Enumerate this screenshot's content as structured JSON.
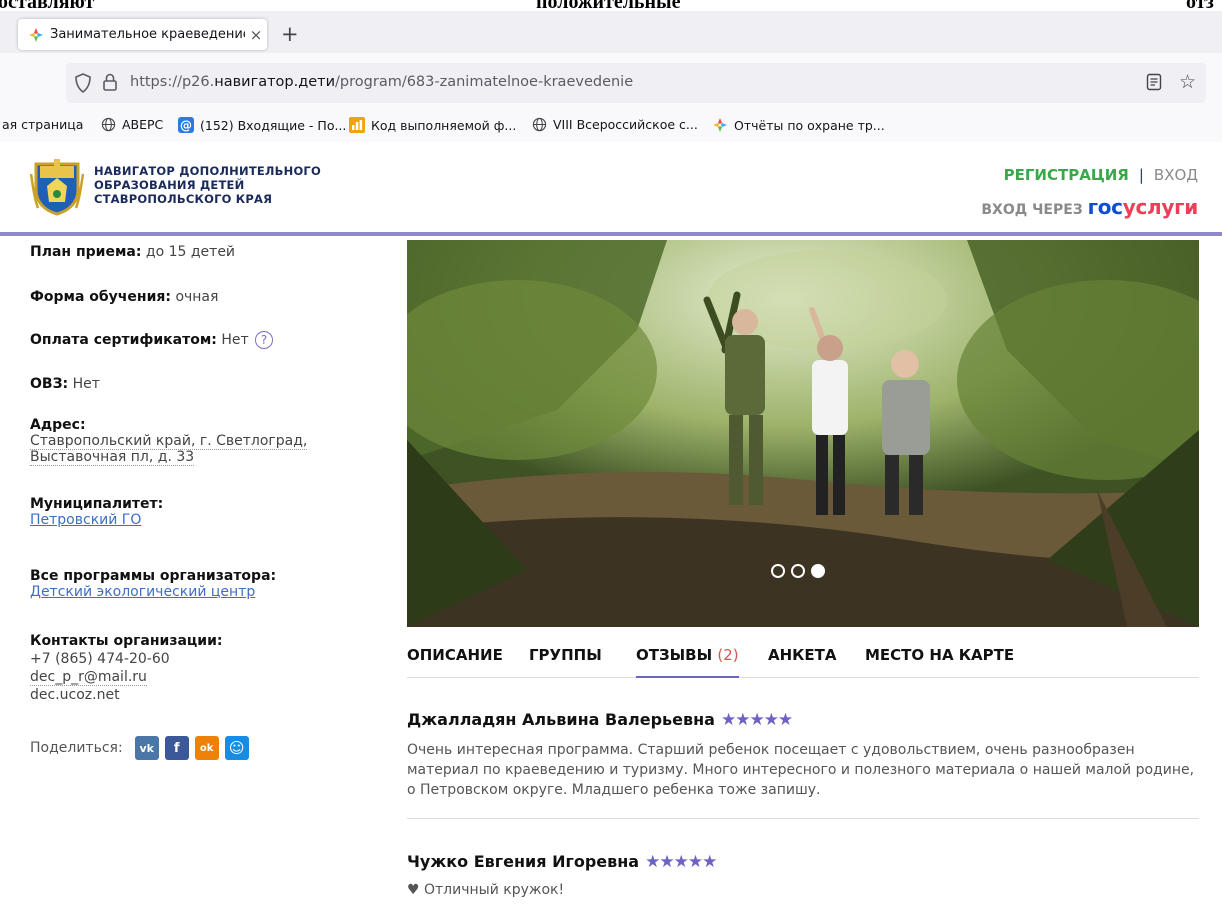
{
  "doc_crop": {
    "left": "оставляют",
    "mid": "положительные",
    "right": "отз"
  },
  "browser": {
    "tab_title": "Занимательное краеведение",
    "tab_close": "×",
    "new_tab": "+",
    "url_prefix": "https://p26.",
    "url_domain": "навигатор.дети",
    "url_path": "/program/683-zanimatelnoe-kraevedenie",
    "bookmarks": [
      {
        "label": "ая страница",
        "icon": "none"
      },
      {
        "label": "ABEPC",
        "icon": "globe-icon"
      },
      {
        "label": "(152) Входящие - По...",
        "icon": "mail-icon"
      },
      {
        "label": "Код выполняемой ф...",
        "icon": "bars-icon"
      },
      {
        "label": "VIII Всероссийское с...",
        "icon": "globe-icon"
      },
      {
        "label": "Отчёты по охране тр...",
        "icon": "flower-icon"
      }
    ]
  },
  "header": {
    "brand_line1": "НАВИГАТОР ДОПОЛНИТЕЛЬНОГО",
    "brand_line2": "ОБРАЗОВАНИЯ ДЕТЕЙ",
    "brand_line3": "СТАВРОПОЛЬСКОГО КРАЯ",
    "register": "РЕГИСТРАЦИЯ",
    "separator": "|",
    "login": "ВХОД",
    "gos_prefix": "ВХОД ЧЕРЕЗ",
    "gos_part1": "гос",
    "gos_part2": "услуги"
  },
  "details": {
    "plan_label": "План приема:",
    "plan_value": "до 15 детей",
    "form_label": "Форма обучения:",
    "form_value": "очная",
    "payment_label": "Оплата сертификатом:",
    "payment_value": "Нет",
    "help": "?",
    "ovz_label": "ОВЗ:",
    "ovz_value": "Нет",
    "address_label": "Адрес:",
    "address_line1": "Ставропольский край, г. Светлоград,",
    "address_line2": "Выставочная пл, д. 33",
    "municipality_label": "Муниципалитет:",
    "municipality_value": "Петровский ГО",
    "programs_label": "Все программы организатора:",
    "programs_value": "Детский экологический центр",
    "contacts_label": "Контакты организации:",
    "phone": "+7 (865) 474-20-60",
    "email": "dec_p_r@mail.ru",
    "site": "dec.ucoz.net",
    "share_label": "Поделиться:",
    "share_vk": "vk",
    "share_fb": "f",
    "share_ok": "ok",
    "share_mm": "☺"
  },
  "tabs": {
    "description": "ОПИСАНИЕ",
    "groups": "ГРУППЫ",
    "reviews": "ОТЗЫВЫ",
    "reviews_count": "(2)",
    "form": "АНКЕТА",
    "map": "МЕСТО НА КАРТЕ"
  },
  "reviews": [
    {
      "author": "Джалладян Альвина Валерьевна",
      "stars": "★★★★★",
      "text": "Очень интересная программа. Старший ребенок посещает с удовольствием, очень разнообразен материал по краеведению и туризму. Много интересного и полезного материала о нашей малой родине, о Петровском округе. Младшего ребенка тоже запишу."
    },
    {
      "author": "Чужко Евгения Игоревна",
      "stars": "★★★★★",
      "text": "♥ Отличный кружок!"
    }
  ],
  "carousel": {
    "slides": 3,
    "active": 3
  },
  "colors": {
    "accent": "#6d63c5",
    "green": "#3aa84a",
    "link": "#3d6ec8",
    "header_rule": "#8e87d0"
  }
}
